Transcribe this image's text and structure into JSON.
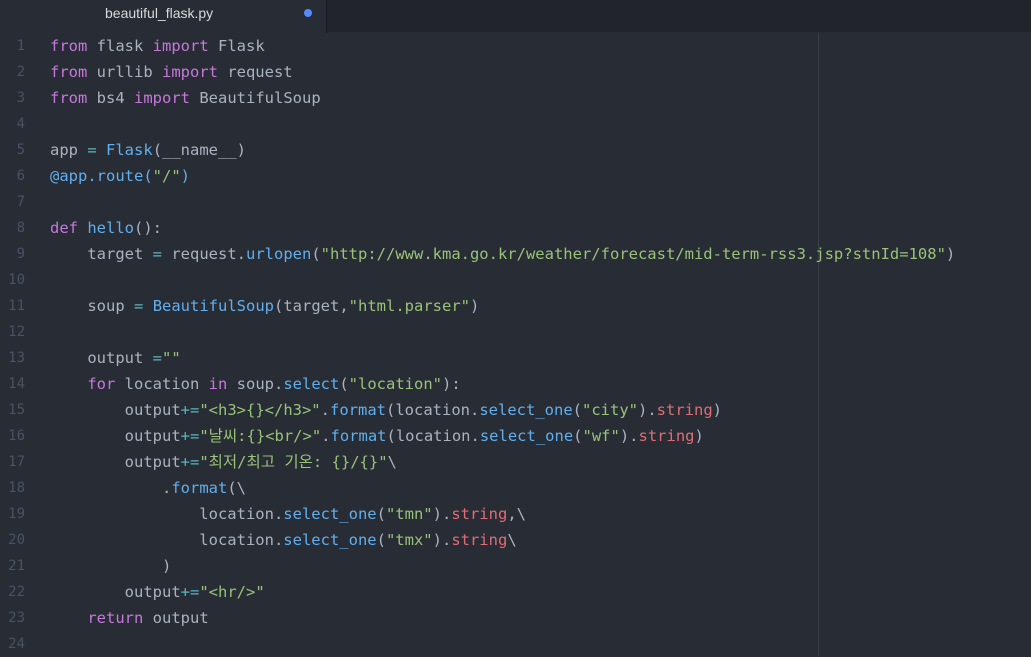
{
  "tab": {
    "filename": "beautiful_flask.py",
    "modified_dot_color": "#528bff"
  },
  "editor": {
    "line_numbers": [
      "1",
      "2",
      "3",
      "4",
      "5",
      "6",
      "7",
      "8",
      "9",
      "10",
      "11",
      "12",
      "13",
      "14",
      "15",
      "16",
      "17",
      "18",
      "19",
      "20",
      "21",
      "22",
      "23",
      "24"
    ],
    "lines": [
      [
        {
          "t": "from",
          "c": "kw"
        },
        {
          "t": " flask ",
          "c": "plain"
        },
        {
          "t": "import",
          "c": "kw"
        },
        {
          "t": " Flask",
          "c": "plain"
        }
      ],
      [
        {
          "t": "from",
          "c": "kw"
        },
        {
          "t": " urllib ",
          "c": "plain"
        },
        {
          "t": "import",
          "c": "kw"
        },
        {
          "t": " request",
          "c": "plain"
        }
      ],
      [
        {
          "t": "from",
          "c": "kw"
        },
        {
          "t": " bs4 ",
          "c": "plain"
        },
        {
          "t": "import",
          "c": "kw"
        },
        {
          "t": " BeautifulSoup",
          "c": "plain"
        }
      ],
      [],
      [
        {
          "t": "app ",
          "c": "plain"
        },
        {
          "t": "=",
          "c": "op"
        },
        {
          "t": " ",
          "c": "plain"
        },
        {
          "t": "Flask",
          "c": "fn"
        },
        {
          "t": "(__name__)",
          "c": "plain"
        }
      ],
      [
        {
          "t": "@app.route(",
          "c": "fn"
        },
        {
          "t": "\"/\"",
          "c": "str"
        },
        {
          "t": ")",
          "c": "fn"
        }
      ],
      [],
      [
        {
          "t": "def",
          "c": "kw"
        },
        {
          "t": " ",
          "c": "plain"
        },
        {
          "t": "hello",
          "c": "fn"
        },
        {
          "t": "():",
          "c": "plain"
        }
      ],
      [
        {
          "t": "    target ",
          "c": "plain"
        },
        {
          "t": "=",
          "c": "op"
        },
        {
          "t": " request.",
          "c": "plain"
        },
        {
          "t": "urlopen",
          "c": "fn"
        },
        {
          "t": "(",
          "c": "plain"
        },
        {
          "t": "\"http://www.kma.go.kr/weather/forecast/mid-term-rss3.jsp?stnId=108\"",
          "c": "str"
        },
        {
          "t": ")",
          "c": "plain"
        }
      ],
      [],
      [
        {
          "t": "    soup ",
          "c": "plain"
        },
        {
          "t": "=",
          "c": "op"
        },
        {
          "t": " ",
          "c": "plain"
        },
        {
          "t": "BeautifulSoup",
          "c": "fn"
        },
        {
          "t": "(target,",
          "c": "plain"
        },
        {
          "t": "\"html.parser\"",
          "c": "str"
        },
        {
          "t": ")",
          "c": "plain"
        }
      ],
      [],
      [
        {
          "t": "    output ",
          "c": "plain"
        },
        {
          "t": "=",
          "c": "op"
        },
        {
          "t": "\"\"",
          "c": "str"
        }
      ],
      [
        {
          "t": "    ",
          "c": "plain"
        },
        {
          "t": "for",
          "c": "kw"
        },
        {
          "t": " location ",
          "c": "plain"
        },
        {
          "t": "in",
          "c": "kw"
        },
        {
          "t": " soup.",
          "c": "plain"
        },
        {
          "t": "select",
          "c": "fn"
        },
        {
          "t": "(",
          "c": "plain"
        },
        {
          "t": "\"location\"",
          "c": "str"
        },
        {
          "t": "):",
          "c": "plain"
        }
      ],
      [
        {
          "t": "        output",
          "c": "plain"
        },
        {
          "t": "+=",
          "c": "op"
        },
        {
          "t": "\"<h3>{}</h3>\"",
          "c": "str"
        },
        {
          "t": ".",
          "c": "plain"
        },
        {
          "t": "format",
          "c": "fn"
        },
        {
          "t": "(location.",
          "c": "plain"
        },
        {
          "t": "select_one",
          "c": "fn"
        },
        {
          "t": "(",
          "c": "plain"
        },
        {
          "t": "\"city\"",
          "c": "str"
        },
        {
          "t": ").",
          "c": "plain"
        },
        {
          "t": "string",
          "c": "prop"
        },
        {
          "t": ")",
          "c": "plain"
        }
      ],
      [
        {
          "t": "        output",
          "c": "plain"
        },
        {
          "t": "+=",
          "c": "op"
        },
        {
          "t": "\"날씨:{}<br/>\"",
          "c": "str"
        },
        {
          "t": ".",
          "c": "plain"
        },
        {
          "t": "format",
          "c": "fn"
        },
        {
          "t": "(location.",
          "c": "plain"
        },
        {
          "t": "select_one",
          "c": "fn"
        },
        {
          "t": "(",
          "c": "plain"
        },
        {
          "t": "\"wf\"",
          "c": "str"
        },
        {
          "t": ").",
          "c": "plain"
        },
        {
          "t": "string",
          "c": "prop"
        },
        {
          "t": ")",
          "c": "plain"
        }
      ],
      [
        {
          "t": "        output",
          "c": "plain"
        },
        {
          "t": "+=",
          "c": "op"
        },
        {
          "t": "\"최저/최고 기온: {}/{}\"",
          "c": "str"
        },
        {
          "t": "\\",
          "c": "plain"
        }
      ],
      [
        {
          "t": "            .",
          "c": "plain"
        },
        {
          "t": "format",
          "c": "fn"
        },
        {
          "t": "(\\",
          "c": "plain"
        }
      ],
      [
        {
          "t": "                location.",
          "c": "plain"
        },
        {
          "t": "select_one",
          "c": "fn"
        },
        {
          "t": "(",
          "c": "plain"
        },
        {
          "t": "\"tmn\"",
          "c": "str"
        },
        {
          "t": ").",
          "c": "plain"
        },
        {
          "t": "string",
          "c": "prop"
        },
        {
          "t": ",\\",
          "c": "plain"
        }
      ],
      [
        {
          "t": "                location.",
          "c": "plain"
        },
        {
          "t": "select_one",
          "c": "fn"
        },
        {
          "t": "(",
          "c": "plain"
        },
        {
          "t": "\"tmx\"",
          "c": "str"
        },
        {
          "t": ").",
          "c": "plain"
        },
        {
          "t": "string",
          "c": "prop"
        },
        {
          "t": "\\",
          "c": "plain"
        }
      ],
      [
        {
          "t": "            )",
          "c": "plain"
        }
      ],
      [
        {
          "t": "        output",
          "c": "plain"
        },
        {
          "t": "+=",
          "c": "op"
        },
        {
          "t": "\"<hr/>\"",
          "c": "str"
        }
      ],
      [
        {
          "t": "    ",
          "c": "plain"
        },
        {
          "t": "return",
          "c": "kw"
        },
        {
          "t": " output",
          "c": "plain"
        }
      ],
      []
    ]
  }
}
